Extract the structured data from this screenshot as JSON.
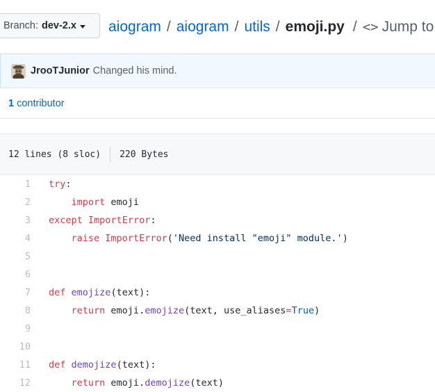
{
  "branch": {
    "label": "Branch:",
    "value": "dev-2.x"
  },
  "breadcrumb": {
    "repo": "aiogram",
    "dirs": [
      "aiogram",
      "utils"
    ],
    "file": "emoji.py",
    "jump_label": "Jump to",
    "separator": "/"
  },
  "commit": {
    "author": "JrooTJunior",
    "message": "Changed his mind."
  },
  "contributors": {
    "count": "1",
    "label": "contributor"
  },
  "file_info": {
    "lines": "12 lines (8 sloc)",
    "size": "220 Bytes"
  },
  "code_lines": [
    {
      "n": "1",
      "tokens": [
        [
          "kw",
          "try"
        ],
        [
          "t",
          ":"
        ]
      ]
    },
    {
      "n": "2",
      "tokens": [
        [
          "t",
          "    "
        ],
        [
          "kw",
          "import"
        ],
        [
          "t",
          " emoji"
        ]
      ]
    },
    {
      "n": "3",
      "tokens": [
        [
          "kw",
          "except"
        ],
        [
          "t",
          " "
        ],
        [
          "kw",
          "ImportError"
        ],
        [
          "t",
          ":"
        ]
      ]
    },
    {
      "n": "4",
      "tokens": [
        [
          "t",
          "    "
        ],
        [
          "kw",
          "raise"
        ],
        [
          "t",
          " "
        ],
        [
          "kw",
          "ImportError"
        ],
        [
          "t",
          "("
        ],
        [
          "str",
          "'Need install \"emoji\" module.'"
        ],
        [
          "t",
          ")"
        ]
      ]
    },
    {
      "n": "5",
      "tokens": []
    },
    {
      "n": "6",
      "tokens": []
    },
    {
      "n": "7",
      "tokens": [
        [
          "kw",
          "def"
        ],
        [
          "t",
          " "
        ],
        [
          "fn",
          "emojize"
        ],
        [
          "t",
          "(text):"
        ]
      ]
    },
    {
      "n": "8",
      "tokens": [
        [
          "t",
          "    "
        ],
        [
          "kw",
          "return"
        ],
        [
          "t",
          " emoji."
        ],
        [
          "fn",
          "emojize"
        ],
        [
          "t",
          "(text, use_aliases"
        ],
        [
          "kw",
          "="
        ],
        [
          "cst",
          "True"
        ],
        [
          "t",
          ")"
        ]
      ]
    },
    {
      "n": "9",
      "tokens": []
    },
    {
      "n": "10",
      "tokens": []
    },
    {
      "n": "11",
      "tokens": [
        [
          "kw",
          "def"
        ],
        [
          "t",
          " "
        ],
        [
          "fn",
          "demojize"
        ],
        [
          "t",
          "(text):"
        ]
      ]
    },
    {
      "n": "12",
      "tokens": [
        [
          "t",
          "    "
        ],
        [
          "kw",
          "return"
        ],
        [
          "t",
          " emoji."
        ],
        [
          "fn",
          "demojize"
        ],
        [
          "t",
          "(text)"
        ]
      ]
    }
  ],
  "colors": {
    "link": "#0366d6",
    "keyword": "#d73a49",
    "function": "#6f42c1",
    "string": "#032f62",
    "constant": "#005cc5"
  }
}
